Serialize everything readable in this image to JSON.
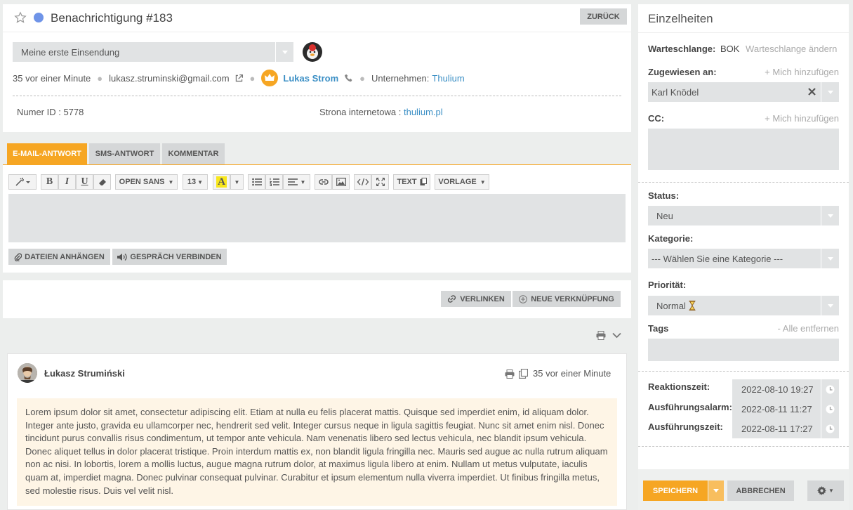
{
  "header": {
    "title": "Benachrichtigung #183",
    "back_label": "ZURÜCK",
    "submission_select": "Meine erste Einsendung"
  },
  "contact": {
    "time": "35 vor einer Minute",
    "email": "lukasz.struminski@gmail.com",
    "name": "Lukas Strom",
    "company_label": "Unternehmen:",
    "company": "Thulium",
    "id_label": "Numer ID : 5778",
    "website_label": "Strona internetowa :",
    "website": "thulium.pl"
  },
  "tabs": [
    {
      "label": "E-MAIL-ANTWORT",
      "active": true
    },
    {
      "label": "SMS-ANTWORT",
      "active": false
    },
    {
      "label": "KOMMENTAR",
      "active": false
    }
  ],
  "toolbar": {
    "font": "OPEN SANS",
    "size": "13",
    "text_label": "TEXT",
    "template_label": "VORLAGE",
    "attach_label": "DATEIEN ANHÄNGEN",
    "call_label": "GESPRÄCH VERBINDEN"
  },
  "links": {
    "link_label": "VERLINKEN",
    "new_link_label": "NEUE VERKNÜPFUNG"
  },
  "message": {
    "author": "Łukasz Strumiński",
    "time": "35 vor einer Minute",
    "body": "Lorem ipsum dolor sit amet, consectetur adipiscing elit. Etiam at nulla eu felis placerat mattis. Quisque sed imperdiet enim, id aliquam dolor. Integer ante justo, gravida eu ullamcorper nec, hendrerit sed velit. Integer cursus neque in ligula sagittis feugiat. Nunc sit amet enim nisl. Donec tincidunt purus convallis risus condimentum, ut tempor ante vehicula. Nam venenatis libero sed lectus vehicula, nec blandit ipsum vehicula. Donec aliquet tellus in dolor placerat tristique. Proin interdum mattis ex, non blandit ligula fringilla nec. Mauris sed augue ac nulla rutrum aliquam non ac nisi. In lobortis, lorem a mollis luctus, augue magna rutrum dolor, at maximus ligula libero at enim. Nullam ut metus vulputate, iaculis quam at, imperdiet magna. Donec pulvinar consequat pulvinar. Curabitur et ipsum elementum nulla viverra imperdiet. Ut finibus fringilla metus, sed molestie risus. Duis vel velit nisl."
  },
  "details": {
    "title": "Einzelheiten",
    "queue_label": "Warteschlange:",
    "queue_value": "BOK",
    "queue_change": "Warteschlange ändern",
    "assigned_label": "Zugewiesen an:",
    "add_me": "+ Mich hinzufügen",
    "assigned_value": "Karl Knödel",
    "cc_label": "CC:",
    "cc_add_me": "+ Mich hinzufügen",
    "status_label": "Status:",
    "status_value": "Neu",
    "category_label": "Kategorie:",
    "category_value": "--- Wählen Sie eine Kategorie ---",
    "priority_label": "Priorität:",
    "priority_value": "Normal",
    "tags_label": "Tags",
    "remove_all": "- Alle entfernen",
    "reaction_label": "Reaktionszeit:",
    "reaction_value": "2022-08-10 19:27",
    "alarm_label": "Ausführungsalarm:",
    "alarm_value": "2022-08-11 11:27",
    "exec_label": "Ausführungszeit:",
    "exec_value": "2022-08-11 17:27",
    "save_label": "SPEICHERN",
    "cancel_label": "ABBRECHEN"
  },
  "colors": {
    "accent": "#f6a623",
    "link": "#3b8fc5",
    "status_dot": "#6f94e8",
    "message_bg": "#fef5e6"
  }
}
